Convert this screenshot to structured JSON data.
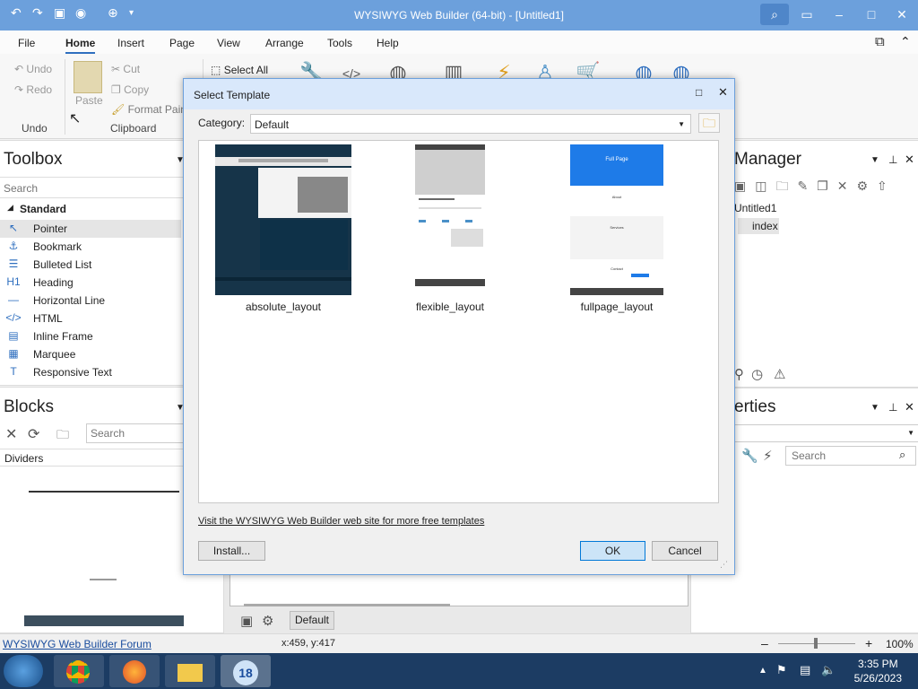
{
  "window": {
    "title": "WYSIWYG Web Builder (64-bit) - [Untitled1]"
  },
  "menu": {
    "items": [
      "File",
      "Home",
      "Insert",
      "Page",
      "View",
      "Arrange",
      "Tools",
      "Help"
    ],
    "active": "Home"
  },
  "ribbon": {
    "undo": "Undo",
    "redo": "Redo",
    "undo_group": "Undo",
    "paste": "Paste",
    "cut": "Cut",
    "copy": "Copy",
    "format_painter": "Format Pain",
    "clipboard_group": "Clipboard",
    "select_all": "Select All"
  },
  "toolbox": {
    "title": "Toolbox",
    "search_placeholder": "Search",
    "category": "Standard",
    "items": [
      {
        "label": "Pointer",
        "icon": "pointer-icon",
        "glyph": "↖"
      },
      {
        "label": "Bookmark",
        "icon": "anchor-icon",
        "glyph": "⚓"
      },
      {
        "label": "Bulleted List",
        "icon": "list-icon",
        "glyph": "☰"
      },
      {
        "label": "Heading",
        "icon": "heading-icon",
        "glyph": "H1"
      },
      {
        "label": "Horizontal Line",
        "icon": "hline-icon",
        "glyph": "—"
      },
      {
        "label": "HTML",
        "icon": "code-icon",
        "glyph": "</>"
      },
      {
        "label": "Inline Frame",
        "icon": "frame-icon",
        "glyph": "▤"
      },
      {
        "label": "Marquee",
        "icon": "marquee-icon",
        "glyph": "▦"
      },
      {
        "label": "Responsive Text",
        "icon": "text-icon",
        "glyph": "T"
      }
    ]
  },
  "blocks": {
    "title": "Blocks",
    "search_placeholder": "Search",
    "category": "Dividers"
  },
  "site_manager": {
    "title": "Manager",
    "tree": [
      "Untitled1",
      "index"
    ]
  },
  "properties": {
    "title": "erties",
    "search_placeholder": "Search"
  },
  "dialog": {
    "title": "Select Template",
    "category_label": "Category:",
    "category_value": "Default",
    "templates": [
      {
        "name": "absolute_layout"
      },
      {
        "name": "flexible_layout"
      },
      {
        "name": "fullpage_layout",
        "thumb_heading": "Full Page",
        "sections": [
          "About",
          "Services",
          "Contact"
        ]
      }
    ],
    "link": "Visit the WYSIWYG Web Builder web site for more free templates",
    "install": "Install...",
    "ok": "OK",
    "cancel": "Cancel"
  },
  "page_tab": "Default",
  "status": {
    "link": "WYSIWYG Web Builder Forum",
    "coords": "x:459, y:417",
    "zoom": "100%"
  },
  "taskbar": {
    "time": "3:35 PM",
    "date": "5/26/2023"
  },
  "colors": {
    "accent": "#6ca0dc",
    "ok_border": "#0078d7",
    "taskbar": "#1c3c63"
  }
}
